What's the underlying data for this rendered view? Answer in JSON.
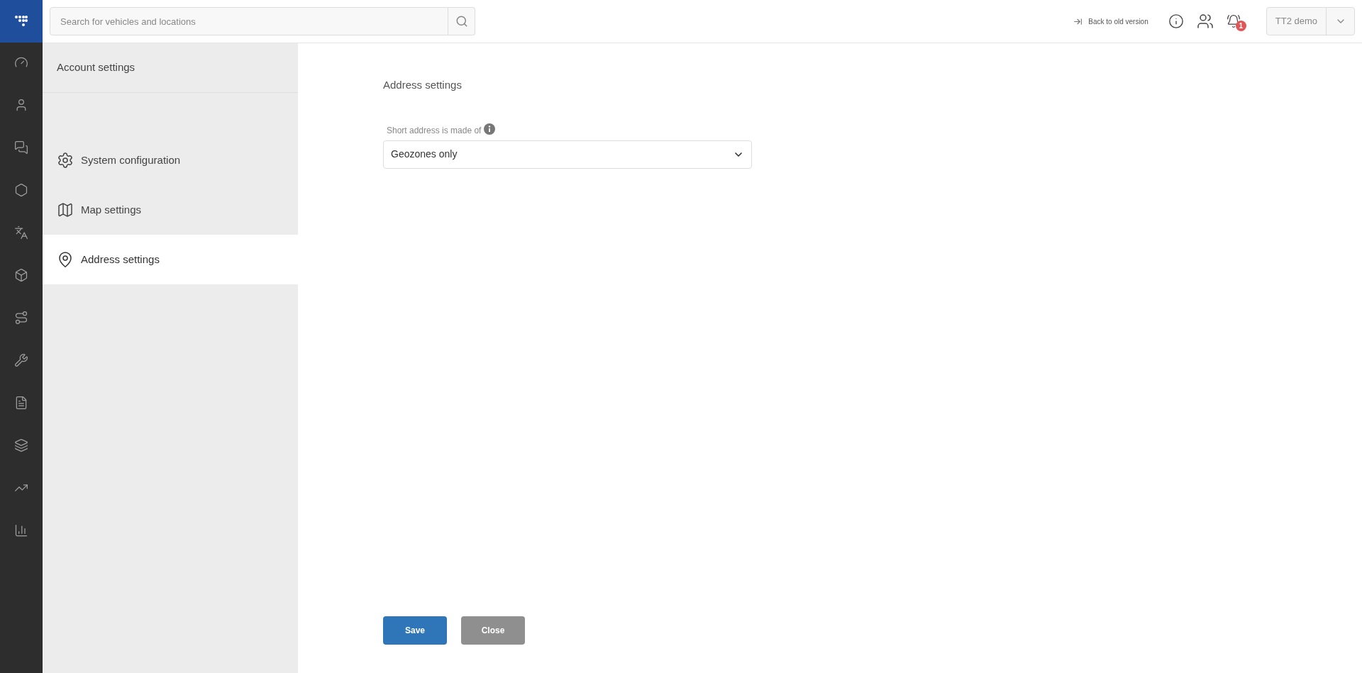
{
  "search": {
    "placeholder": "Search for vehicles and locations"
  },
  "header": {
    "back_link": "Back to old version",
    "notification_count": "1",
    "account": "TT2 demo"
  },
  "settings_nav": {
    "title": "Account settings",
    "items": [
      {
        "label": "System configuration",
        "selected": false
      },
      {
        "label": "Map settings",
        "selected": false
      },
      {
        "label": "Address settings",
        "selected": true
      }
    ]
  },
  "content": {
    "title": "Address settings",
    "field": {
      "label": "Short address is made of",
      "value": "Geozones only"
    }
  },
  "buttons": [
    {
      "label": "Save",
      "kind": "primary"
    },
    {
      "label": "Close",
      "kind": "secondary"
    }
  ]
}
